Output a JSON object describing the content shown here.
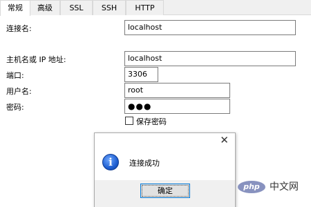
{
  "tabs": [
    "常规",
    "高级",
    "SSL",
    "SSH",
    "HTTP"
  ],
  "form": {
    "connection_name_label": "连接名:",
    "connection_name_value": "localhost",
    "host_label": "主机名或 IP 地址:",
    "host_value": "localhost",
    "port_label": "端口:",
    "port_value": "3306",
    "username_label": "用户名:",
    "username_value": "root",
    "password_label": "密码:",
    "password_value": "●●●",
    "save_password_label": "保存密码"
  },
  "dialog": {
    "close_glyph": "✕",
    "icon_glyph": "i",
    "message": "连接成功",
    "ok_label": "确定"
  },
  "watermark": {
    "logo_text": "php",
    "text": "中文网"
  }
}
